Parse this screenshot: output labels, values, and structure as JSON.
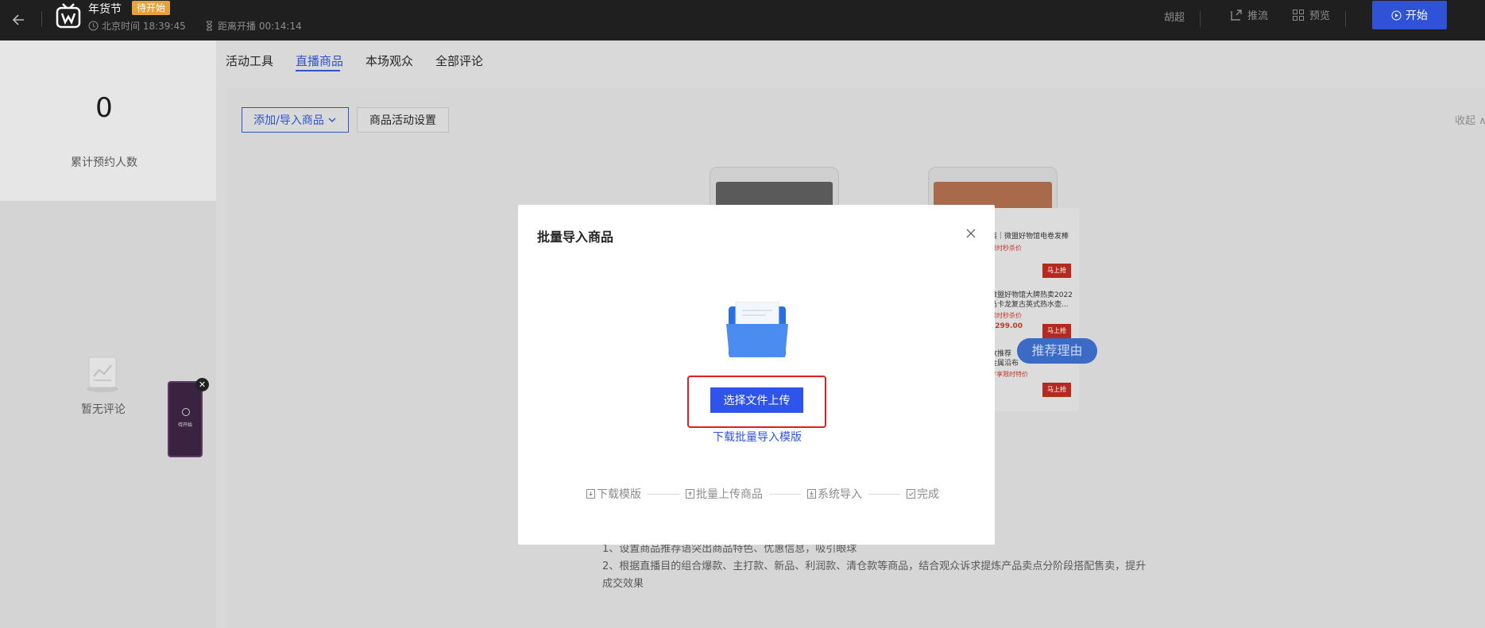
{
  "topbar": {
    "event_title": "年货节",
    "status_badge": "待开始",
    "beijing_time": "北京时间 18:39:45",
    "countdown": "距离开播 00:14:14",
    "host_name": "胡超",
    "promote_label": "推流",
    "preview_label": "预览",
    "start_label": "开始"
  },
  "left_panel": {
    "stat_value": "0",
    "stat_label": "累计预约人数",
    "empty_comments": "暂无评论",
    "mini_player_text": "待开始"
  },
  "tabs": [
    {
      "label": "活动工具",
      "active": false
    },
    {
      "label": "直播商品",
      "active": true
    },
    {
      "label": "本场观众",
      "active": false
    },
    {
      "label": "全部评论",
      "active": false
    }
  ],
  "toolbar": {
    "add_import_label": "添加/导入商品",
    "activity_settings_label": "商品活动设置",
    "collapse_label": "收起"
  },
  "preview": {
    "products": [
      {
        "title": "装｜微盟好物馆电卷发棒",
        "sub": "限时秒杀价",
        "buy": "马上抢"
      },
      {
        "title": "微盟好物馆大牌热卖2022\n马卡龙复古英式热水壶...",
        "sub": "限时秒杀价",
        "price": "¥299.00",
        "buy": "马上抢"
      },
      {
        "title": "款推荐\n金属沿布",
        "sub": "专享限时特价",
        "buy": "马上抢"
      }
    ],
    "reason_tag": "推荐理由"
  },
  "tips": {
    "line1": "1、设置商品推荐语突出商品特色、优惠信息，吸引眼球",
    "line2": "2、根据直播目的组合爆款、主打款、新品、利润款、清仓款等商品，结合观众诉求提炼产品卖点分阶段搭配售卖，提升成交效果"
  },
  "modal": {
    "title": "批量导入商品",
    "upload_button": "选择文件上传",
    "template_link": "下载批量导入模版",
    "steps": [
      "下载模版",
      "批量上传商品",
      "系统导入",
      "完成"
    ]
  },
  "colors": {
    "primary": "#2f54eb",
    "topbar_bg": "#1f1f1f",
    "badge": "#e6a23c",
    "highlight_border": "#e02020"
  }
}
